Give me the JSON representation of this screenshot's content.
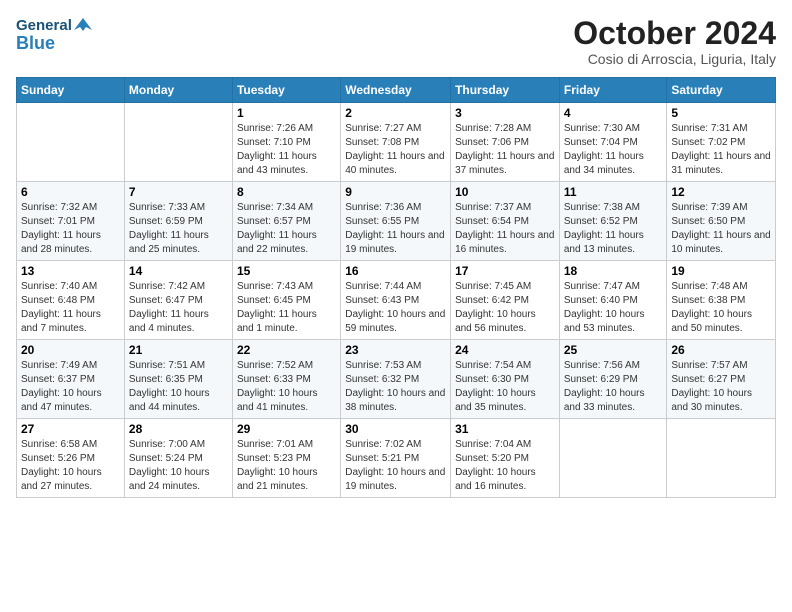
{
  "header": {
    "logo_general": "General",
    "logo_blue": "Blue",
    "month_title": "October 2024",
    "location": "Cosio di Arroscia, Liguria, Italy"
  },
  "weekdays": [
    "Sunday",
    "Monday",
    "Tuesday",
    "Wednesday",
    "Thursday",
    "Friday",
    "Saturday"
  ],
  "weeks": [
    [
      {
        "day": "",
        "info": ""
      },
      {
        "day": "",
        "info": ""
      },
      {
        "day": "1",
        "info": "Sunrise: 7:26 AM\nSunset: 7:10 PM\nDaylight: 11 hours and 43 minutes."
      },
      {
        "day": "2",
        "info": "Sunrise: 7:27 AM\nSunset: 7:08 PM\nDaylight: 11 hours and 40 minutes."
      },
      {
        "day": "3",
        "info": "Sunrise: 7:28 AM\nSunset: 7:06 PM\nDaylight: 11 hours and 37 minutes."
      },
      {
        "day": "4",
        "info": "Sunrise: 7:30 AM\nSunset: 7:04 PM\nDaylight: 11 hours and 34 minutes."
      },
      {
        "day": "5",
        "info": "Sunrise: 7:31 AM\nSunset: 7:02 PM\nDaylight: 11 hours and 31 minutes."
      }
    ],
    [
      {
        "day": "6",
        "info": "Sunrise: 7:32 AM\nSunset: 7:01 PM\nDaylight: 11 hours and 28 minutes."
      },
      {
        "day": "7",
        "info": "Sunrise: 7:33 AM\nSunset: 6:59 PM\nDaylight: 11 hours and 25 minutes."
      },
      {
        "day": "8",
        "info": "Sunrise: 7:34 AM\nSunset: 6:57 PM\nDaylight: 11 hours and 22 minutes."
      },
      {
        "day": "9",
        "info": "Sunrise: 7:36 AM\nSunset: 6:55 PM\nDaylight: 11 hours and 19 minutes."
      },
      {
        "day": "10",
        "info": "Sunrise: 7:37 AM\nSunset: 6:54 PM\nDaylight: 11 hours and 16 minutes."
      },
      {
        "day": "11",
        "info": "Sunrise: 7:38 AM\nSunset: 6:52 PM\nDaylight: 11 hours and 13 minutes."
      },
      {
        "day": "12",
        "info": "Sunrise: 7:39 AM\nSunset: 6:50 PM\nDaylight: 11 hours and 10 minutes."
      }
    ],
    [
      {
        "day": "13",
        "info": "Sunrise: 7:40 AM\nSunset: 6:48 PM\nDaylight: 11 hours and 7 minutes."
      },
      {
        "day": "14",
        "info": "Sunrise: 7:42 AM\nSunset: 6:47 PM\nDaylight: 11 hours and 4 minutes."
      },
      {
        "day": "15",
        "info": "Sunrise: 7:43 AM\nSunset: 6:45 PM\nDaylight: 11 hours and 1 minute."
      },
      {
        "day": "16",
        "info": "Sunrise: 7:44 AM\nSunset: 6:43 PM\nDaylight: 10 hours and 59 minutes."
      },
      {
        "day": "17",
        "info": "Sunrise: 7:45 AM\nSunset: 6:42 PM\nDaylight: 10 hours and 56 minutes."
      },
      {
        "day": "18",
        "info": "Sunrise: 7:47 AM\nSunset: 6:40 PM\nDaylight: 10 hours and 53 minutes."
      },
      {
        "day": "19",
        "info": "Sunrise: 7:48 AM\nSunset: 6:38 PM\nDaylight: 10 hours and 50 minutes."
      }
    ],
    [
      {
        "day": "20",
        "info": "Sunrise: 7:49 AM\nSunset: 6:37 PM\nDaylight: 10 hours and 47 minutes."
      },
      {
        "day": "21",
        "info": "Sunrise: 7:51 AM\nSunset: 6:35 PM\nDaylight: 10 hours and 44 minutes."
      },
      {
        "day": "22",
        "info": "Sunrise: 7:52 AM\nSunset: 6:33 PM\nDaylight: 10 hours and 41 minutes."
      },
      {
        "day": "23",
        "info": "Sunrise: 7:53 AM\nSunset: 6:32 PM\nDaylight: 10 hours and 38 minutes."
      },
      {
        "day": "24",
        "info": "Sunrise: 7:54 AM\nSunset: 6:30 PM\nDaylight: 10 hours and 35 minutes."
      },
      {
        "day": "25",
        "info": "Sunrise: 7:56 AM\nSunset: 6:29 PM\nDaylight: 10 hours and 33 minutes."
      },
      {
        "day": "26",
        "info": "Sunrise: 7:57 AM\nSunset: 6:27 PM\nDaylight: 10 hours and 30 minutes."
      }
    ],
    [
      {
        "day": "27",
        "info": "Sunrise: 6:58 AM\nSunset: 5:26 PM\nDaylight: 10 hours and 27 minutes."
      },
      {
        "day": "28",
        "info": "Sunrise: 7:00 AM\nSunset: 5:24 PM\nDaylight: 10 hours and 24 minutes."
      },
      {
        "day": "29",
        "info": "Sunrise: 7:01 AM\nSunset: 5:23 PM\nDaylight: 10 hours and 21 minutes."
      },
      {
        "day": "30",
        "info": "Sunrise: 7:02 AM\nSunset: 5:21 PM\nDaylight: 10 hours and 19 minutes."
      },
      {
        "day": "31",
        "info": "Sunrise: 7:04 AM\nSunset: 5:20 PM\nDaylight: 10 hours and 16 minutes."
      },
      {
        "day": "",
        "info": ""
      },
      {
        "day": "",
        "info": ""
      }
    ]
  ]
}
